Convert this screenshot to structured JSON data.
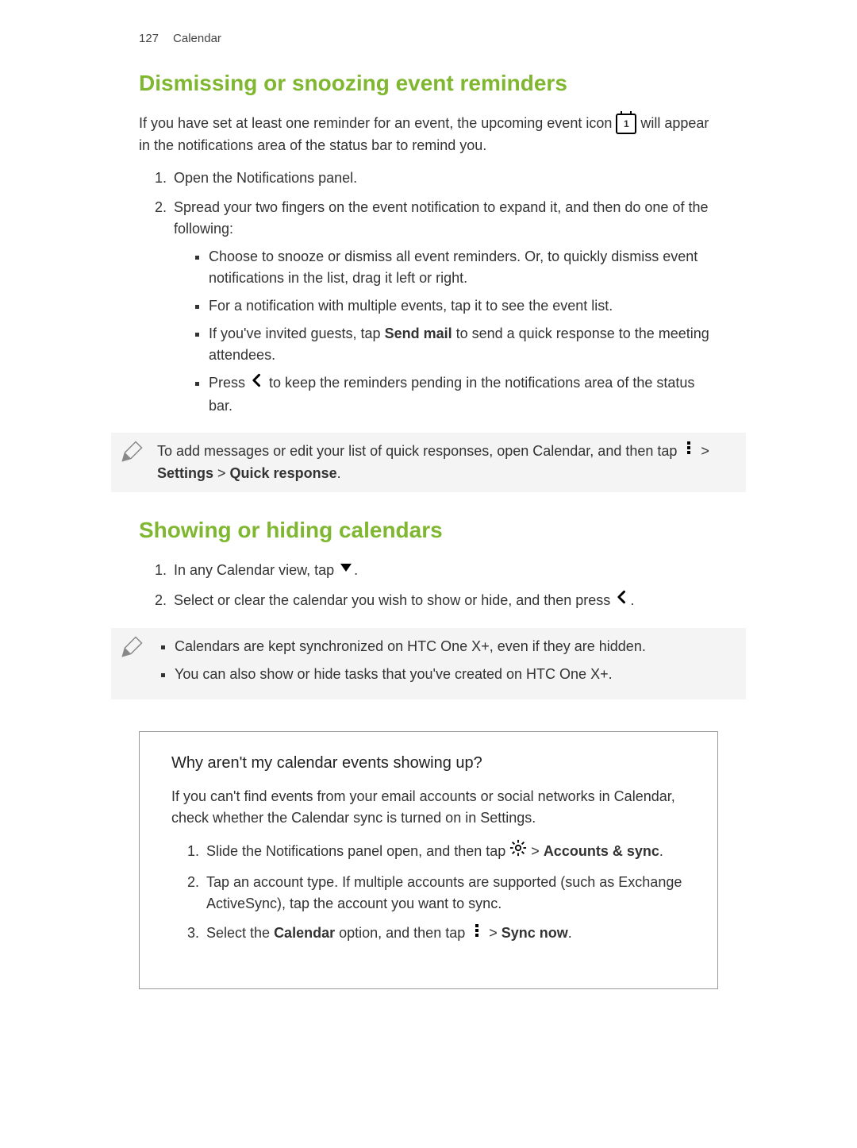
{
  "header": {
    "page_number": "127",
    "chapter": "Calendar"
  },
  "section1": {
    "title": "Dismissing or snoozing event reminders",
    "intro_before_icon": "If you have set at least one reminder for an event, the upcoming event icon ",
    "intro_after_icon": " will appear in the notifications area of the status bar to remind you.",
    "step1": "Open the Notifications panel.",
    "step2": "Spread your two fingers on the event notification to expand it, and then do one of the following:",
    "bullets": {
      "b1": "Choose to snooze or dismiss all event reminders. Or, to quickly dismiss event notifications in the list, drag it left or right.",
      "b2": "For a notification with multiple events, tap it to see the event list.",
      "b3_before": "If you've invited guests, tap ",
      "b3_bold": "Send mail",
      "b3_after": " to send a quick response to the meeting attendees.",
      "b4_before": "Press ",
      "b4_after": " to keep the reminders pending in the notifications area of the status bar."
    },
    "note_before": "To add messages or edit your list of quick responses, open Calendar, and then tap ",
    "note_after_pre": " > ",
    "note_settings": "Settings",
    "note_gt": " > ",
    "note_quick": "Quick response",
    "note_period": "."
  },
  "section2": {
    "title": "Showing or hiding calendars",
    "step1_before": "In any Calendar view, tap ",
    "step1_after": ".",
    "step2_before": "Select or clear the calendar you wish to show or hide, and then press ",
    "step2_after": ".",
    "note_b1": "Calendars are kept synchronized on HTC One X+, even if they are hidden.",
    "note_b2": "You can also show or hide tasks that you've created on HTC One X+."
  },
  "box": {
    "title": "Why aren't my calendar events showing up?",
    "intro": "If you can't find events from your email accounts or social networks in Calendar, check whether the Calendar sync is turned on in Settings.",
    "step1_before": "Slide the Notifications panel open, and then tap ",
    "step1_mid": " > ",
    "step1_bold": "Accounts & sync",
    "step1_period": ".",
    "step2": "Tap an account type. If multiple accounts are supported (such as Exchange ActiveSync), tap the account you want to sync.",
    "step3_before": "Select the ",
    "step3_bold1": "Calendar",
    "step3_mid": " option, and then tap ",
    "step3_gt": " > ",
    "step3_bold2": "Sync now",
    "step3_period": "."
  }
}
